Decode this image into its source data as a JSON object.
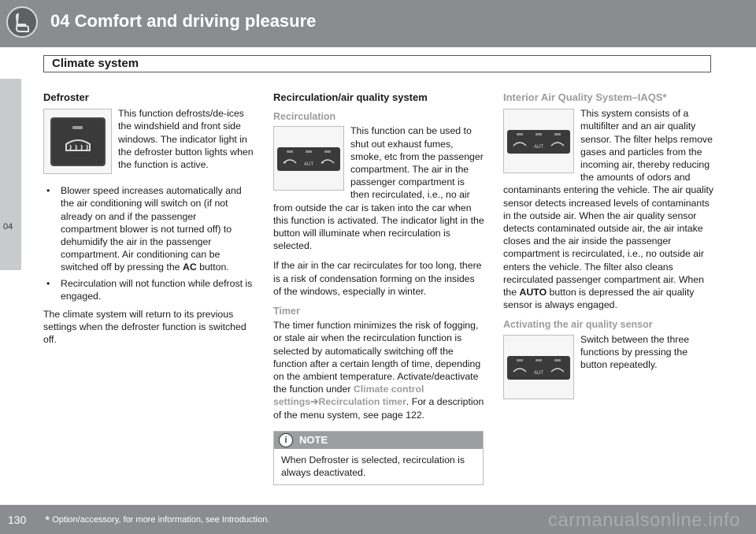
{
  "header": {
    "chapter_title": "04 Comfort and driving pleasure",
    "section_title": "Climate system"
  },
  "side_tab": {
    "label": "04"
  },
  "footer": {
    "page_number": "130",
    "footnote_star": "*",
    "footnote": "Option/accessory, for more information, see Introduction.",
    "watermark": "carmanualsonline.info"
  },
  "defroster": {
    "title": "Defroster",
    "intro": "This function defrosts/de-ices the windshield and front side windows. The indicator light in the defroster button lights when the function is active.",
    "bullet1_a": "Blower speed increases automatically and the air conditioning will switch on (if not already on and if the passenger compartment blower is not turned off) to dehumidify the air in the passenger compartment. Air conditioning can be switched off by pressing the ",
    "bullet1_bold": "AC",
    "bullet1_b": " button.",
    "bullet2": "Recirculation will not function while defrost is engaged.",
    "closing": "The climate system will return to its previous settings when the defroster function is switched off."
  },
  "recirculation": {
    "title": "Recirculation/air quality system",
    "sub1": "Recirculation",
    "p1": "This function can be used to shut out exhaust fumes, smoke, etc from the passenger compartment. The air in the passenger compartment is then recirculated, i.e., no air from outside the car is taken into the car when this function is activated. The indicator light in the button will illuminate when recirculation is selected.",
    "p2": "If the air in the car recirculates for too long, there is a risk of condensation forming on the insides of the windows, especially in winter.",
    "sub2": "Timer",
    "p3_a": "The timer function minimizes the risk of fogging, or stale air when the recirculation function is selected by automatically switching off the function after a certain length of time, depending on the ambient temperature. Activate/deactivate the function under ",
    "link1": "Climate control settings",
    "arrow": "➔",
    "link2": "Recirculation timer",
    "p3_b": ". For a description of the menu system, see page 122.",
    "note_label": "NOTE",
    "note_icon": "i",
    "note_text": "When Defroster is selected, recirculation is always deactivated."
  },
  "iaqs": {
    "title": "Interior Air Quality System–IAQS*",
    "p1_a": "This system consists of a multifilter and an air quality sensor. The filter helps remove gases and particles from the incoming air, thereby reducing the amounts of odors and contaminants entering the vehicle. The air quality sensor detects increased levels of contaminants in the outside air. When the air quality sensor detects contaminated outside air, the air intake closes and the air inside the passenger compartment is recirculated, i.e., no outside air enters the vehicle. The filter also cleans recirculated passenger compartment air. When the ",
    "p1_bold": "AUTO",
    "p1_b": " button is depressed the air quality sensor is always engaged.",
    "sub": "Activating the air quality sensor",
    "p2": "Switch between the three functions by pressing the button repeatedly.",
    "button_text": "AUT"
  }
}
